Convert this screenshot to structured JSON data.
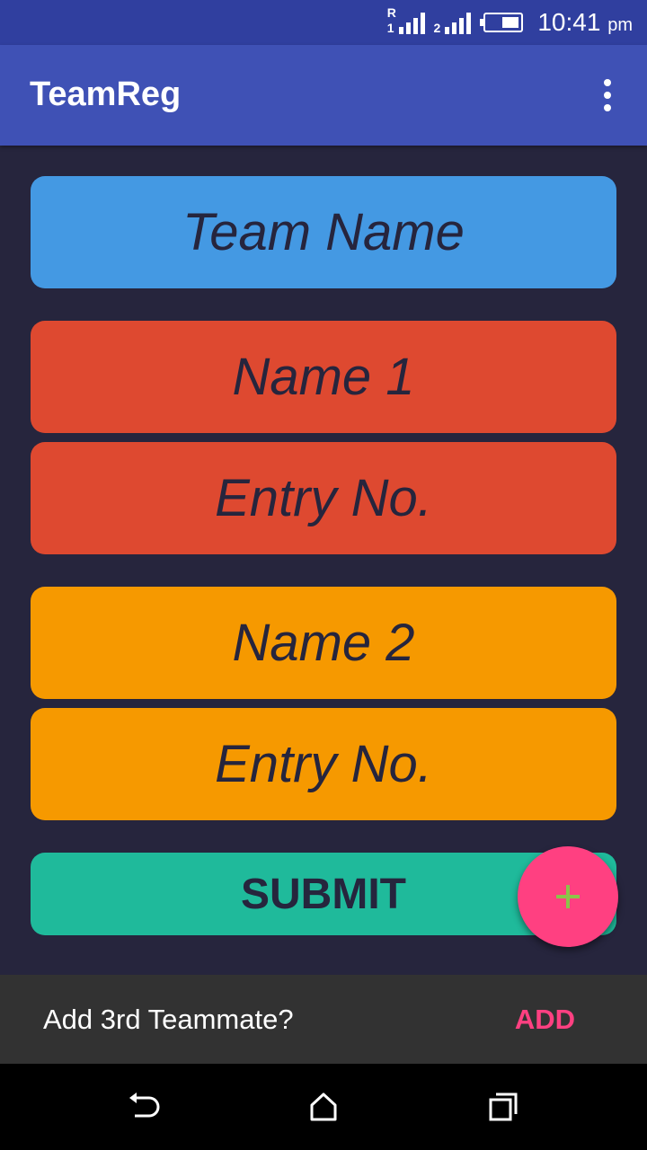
{
  "status_bar": {
    "time": "10:41",
    "ampm": "pm",
    "sim1_label": "R",
    "sim1_num": "1",
    "sim2_num": "2"
  },
  "app_bar": {
    "title": "TeamReg",
    "overflow_icon": "more-vert-icon"
  },
  "form": {
    "team_name_placeholder": "Team Name",
    "member1": {
      "name_placeholder": "Name 1",
      "entry_placeholder": "Entry No."
    },
    "member2": {
      "name_placeholder": "Name 2",
      "entry_placeholder": "Entry No."
    },
    "submit_label": "SUBMIT"
  },
  "fab": {
    "icon": "plus-icon"
  },
  "snackbar": {
    "message": "Add 3rd Teammate?",
    "action_label": "ADD"
  },
  "colors": {
    "team_field": "#4499e3",
    "member1_fields": "#de4930",
    "member2_fields": "#f69900",
    "submit": "#1fba9b",
    "fab": "#ff4081",
    "app_bar": "#3f51b5",
    "background": "#26253d"
  },
  "nav_bar": {
    "icons": [
      "back-icon",
      "home-icon",
      "recent-apps-icon"
    ]
  }
}
